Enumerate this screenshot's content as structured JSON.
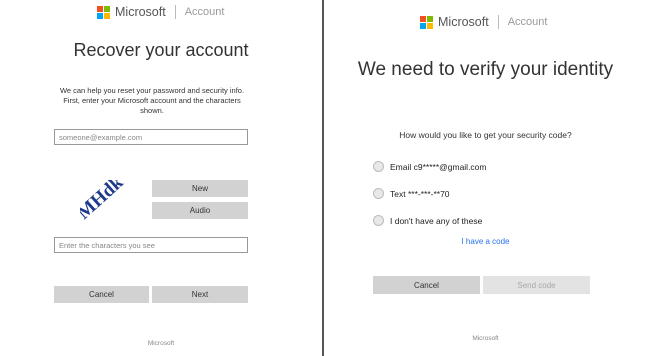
{
  "colors": {
    "logo_red": "#f25022",
    "logo_green": "#7fba00",
    "logo_blue": "#00a4ef",
    "logo_yellow": "#ffb900",
    "button_gray": "#d2d2d2",
    "link_blue": "#2672ec"
  },
  "brand": {
    "name": "Microsoft",
    "section": "Account"
  },
  "recover": {
    "title": "Recover your account",
    "description": "We can help you reset your password and security info. First, enter your Microsoft account and the characters shown.",
    "email_placeholder": "someone@example.com",
    "captcha_text": "MHdk",
    "captcha_icon": "captcha-image",
    "new_label": "New",
    "audio_label": "Audio",
    "chars_placeholder": "Enter the characters you see",
    "cancel_label": "Cancel",
    "next_label": "Next",
    "footer": "Microsoft"
  },
  "verify": {
    "title": "We need to verify your identity",
    "question": "How would you like to get your security code?",
    "options": [
      {
        "label": "Email c9*****@gmail.com"
      },
      {
        "label": "Text ***-***-**70"
      },
      {
        "label": "I don't have any of these"
      }
    ],
    "have_code_label": "I have a code",
    "cancel_label": "Cancel",
    "send_label": "Send code",
    "footer": "Microsoft"
  }
}
